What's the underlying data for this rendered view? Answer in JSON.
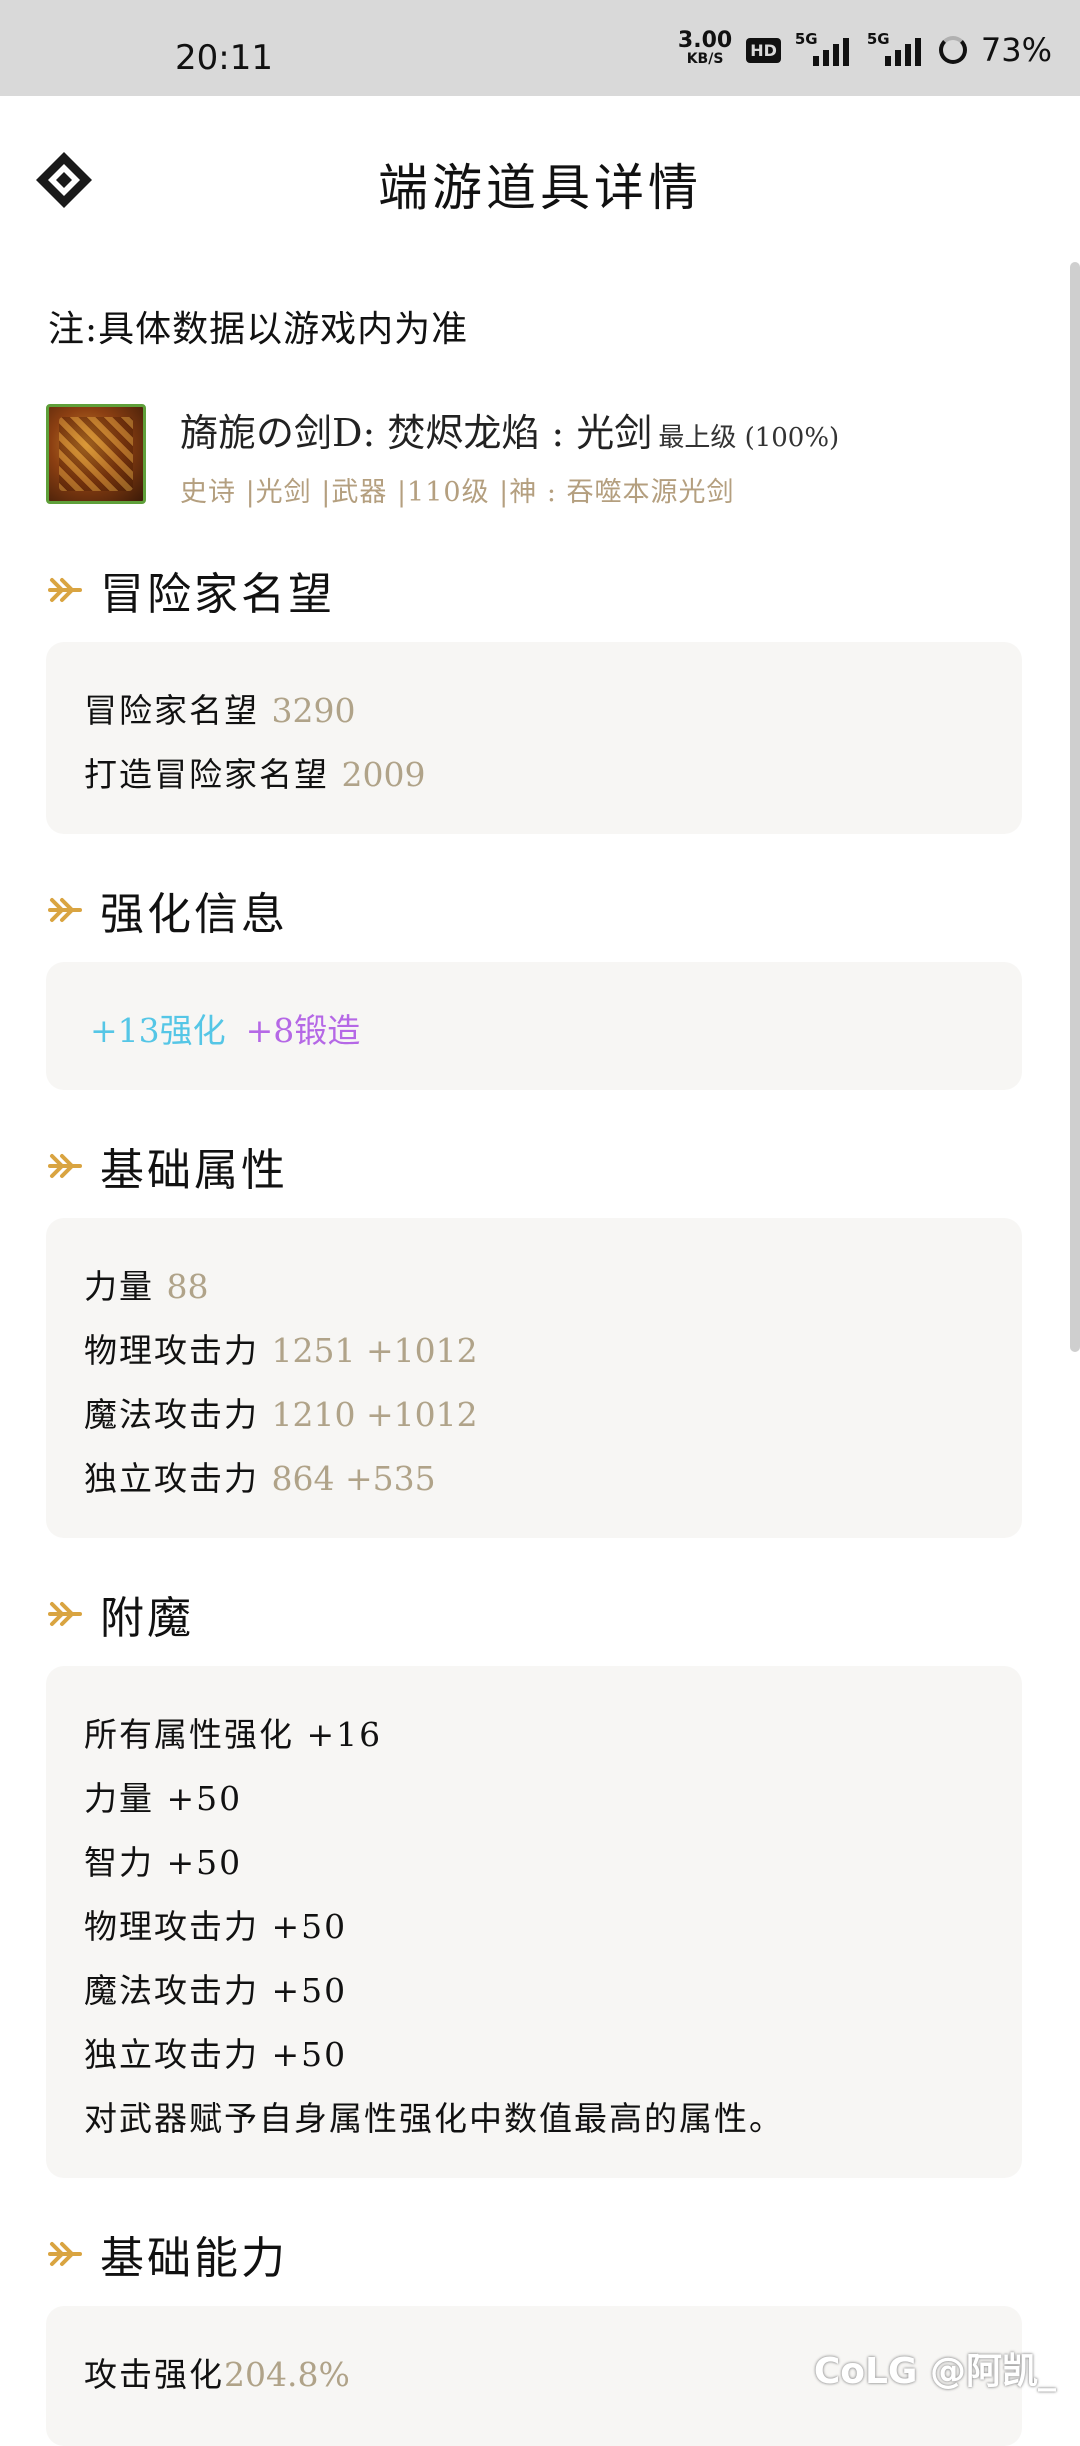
{
  "status_bar": {
    "time": "20:11",
    "net_speed_value": "3.00",
    "net_speed_unit": "KB/S",
    "hd_badge": "HD",
    "signal1_tag": "5G",
    "signal2_tag": "5G",
    "battery": "73%"
  },
  "header": {
    "title": "端游道具详情"
  },
  "note": "注:具体数据以游戏内为准",
  "item": {
    "name": "旖旎の剑D: 焚烬龙焰 : 光剑",
    "level": "最上级 (100%)",
    "tags": "史诗 |光剑 |武器 |110级 |神 : 吞噬本源光剑"
  },
  "sections": {
    "fame": {
      "title": "冒险家名望",
      "rows": [
        {
          "label": "冒险家名望 ",
          "value": "3290"
        },
        {
          "label": "打造冒险家名望 ",
          "value": "2009"
        }
      ]
    },
    "enhance": {
      "title": "强化信息",
      "reinforce": "+13强化",
      "forge": "+8锻造"
    },
    "base_attr": {
      "title": "基础属性",
      "rows": [
        {
          "label": "力量 ",
          "value": "88"
        },
        {
          "label": "物理攻击力 ",
          "value": "1251 +1012"
        },
        {
          "label": "魔法攻击力 ",
          "value": "1210 +1012"
        },
        {
          "label": "独立攻击力 ",
          "value": "864 +535"
        }
      ]
    },
    "enchant": {
      "title": "附魔",
      "rows": [
        "所有属性强化 +16",
        "力量 +50",
        "智力 +50",
        "物理攻击力 +50",
        "魔法攻击力 +50",
        "独立攻击力 +50",
        "对武器赋予自身属性强化中数值最高的属性。"
      ]
    },
    "ability": {
      "title": "基础能力",
      "rows": [
        {
          "label": "攻击强化",
          "value": "204.8%"
        }
      ]
    }
  },
  "watermark": "CoLG @阿凯_",
  "colors": {
    "accent_gold": "#d9a441",
    "value_tan": "#b0a389",
    "reinforce_cyan": "#55c6e6",
    "forge_purple": "#b568e6",
    "card_bg": "#f7f6f4"
  }
}
